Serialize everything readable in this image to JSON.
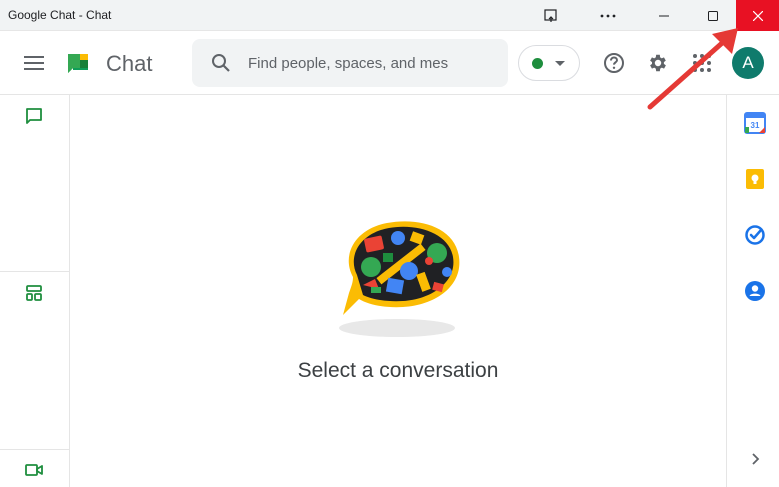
{
  "window": {
    "title": "Google Chat - Chat",
    "controls": [
      "cast-icon",
      "more-icon",
      "minimize-icon",
      "maximize-icon",
      "close-icon"
    ]
  },
  "header": {
    "app_name": "Chat",
    "search_placeholder": "Find people, spaces, and mes",
    "status": "active",
    "avatar_letter": "A"
  },
  "left_rail": {
    "items": [
      "chat-icon",
      "spaces-icon",
      "meet-icon"
    ]
  },
  "right_rail": {
    "items": [
      "calendar-icon",
      "keep-icon",
      "tasks-icon",
      "contacts-icon"
    ],
    "calendar_day": "31"
  },
  "main": {
    "empty_title": "Select a conversation"
  },
  "colors": {
    "brand_green": "#1e8e3e",
    "close_red": "#e81123",
    "avatar": "#0f7b6c",
    "annotation": "#e53935"
  }
}
